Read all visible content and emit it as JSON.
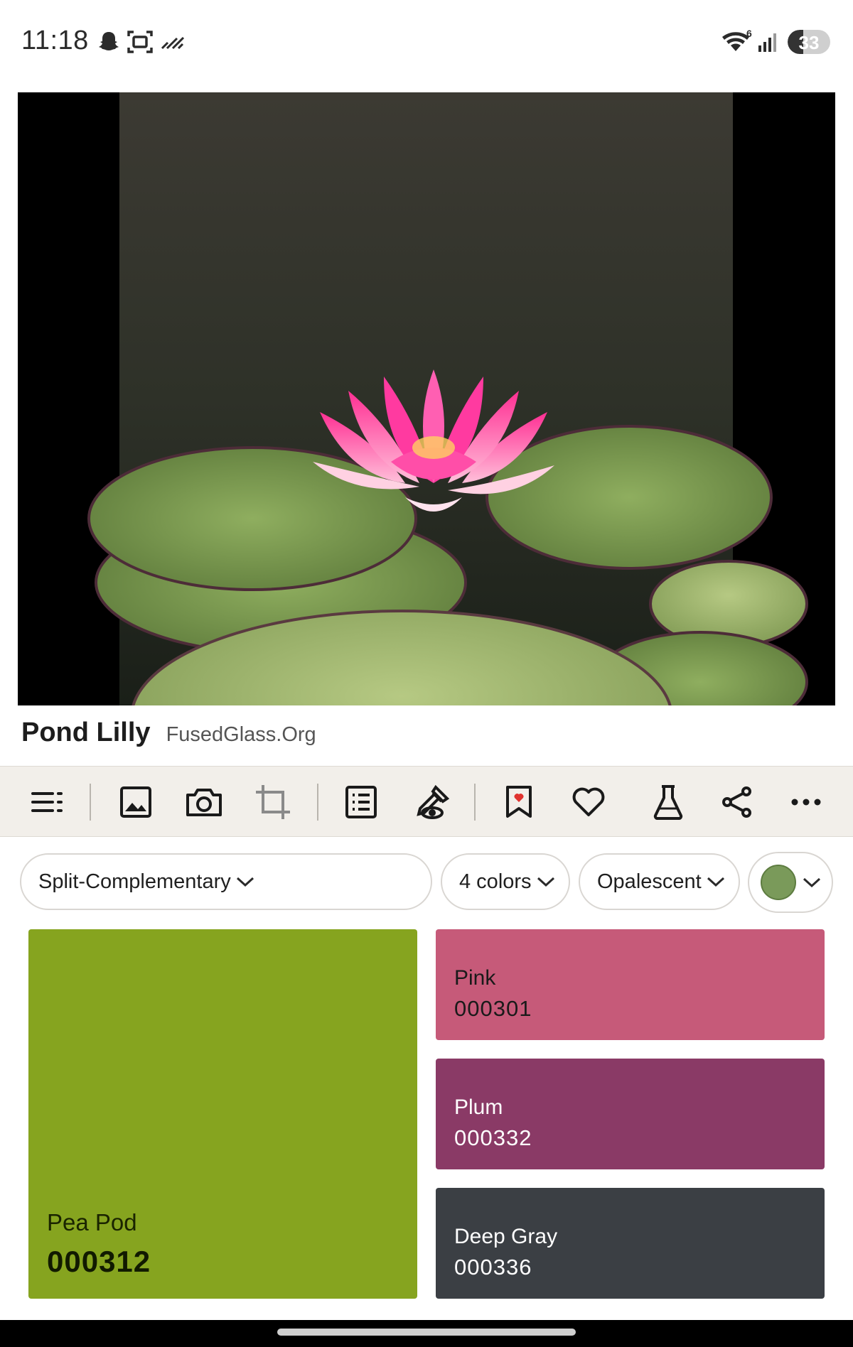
{
  "status_bar": {
    "time": "11:18",
    "battery": "33",
    "icons": [
      "snapchat-ghost-icon",
      "screen-capture-icon",
      "signal-slash-icon",
      "wifi-6-icon",
      "cell-signal-icon",
      "battery-icon"
    ]
  },
  "image": {
    "description_icon": "pond-lily-photo"
  },
  "title": {
    "name": "Pond Lilly",
    "source": "FusedGlass.Org"
  },
  "toolbar": {
    "icons": [
      "menu-icon",
      "gallery-icon",
      "camera-icon",
      "crop-icon",
      "list-icon",
      "eyedropper-icon",
      "bookmark-icon",
      "heart-icon",
      "flask-icon",
      "share-icon",
      "more-icon"
    ]
  },
  "controls": {
    "harmony": "Split-Complementary",
    "count": "4 colors",
    "finish": "Opalescent",
    "swatch_color": "#7a9a5a"
  },
  "colors": [
    {
      "name": "Pea Pod",
      "code": "000312",
      "hex": "#86a41f"
    },
    {
      "name": "Pink",
      "code": "000301",
      "hex": "#c65a79"
    },
    {
      "name": "Plum",
      "code": "000332",
      "hex": "#8a3a66"
    },
    {
      "name": "Deep Gray",
      "code": "000336",
      "hex": "#3b3f44"
    }
  ]
}
